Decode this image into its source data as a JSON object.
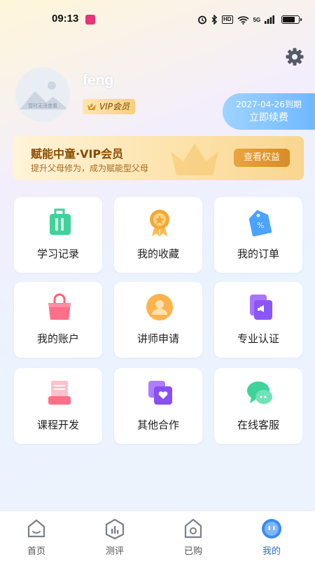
{
  "status_bar": {
    "time": "09:13",
    "net_badge": "HD",
    "sig_badge": "5G"
  },
  "profile": {
    "username": "feng",
    "avatar_caption": "暂时无法查看",
    "vip_badge": "VIP会员",
    "renew_date": "2027-04-26到期",
    "renew_button": "立即续费"
  },
  "vip_banner": {
    "title": "赋能中童·VIP会员",
    "subtitle": "提升父母修为，成为赋能型父母",
    "button": "查看权益"
  },
  "grid": [
    {
      "label": "学习记录",
      "icon": "study-record-icon"
    },
    {
      "label": "我的收藏",
      "icon": "favorites-medal-icon"
    },
    {
      "label": "我的订单",
      "icon": "orders-tag-icon"
    },
    {
      "label": "我的账户",
      "icon": "account-bag-icon"
    },
    {
      "label": "讲师申请",
      "icon": "lecturer-avatar-icon"
    },
    {
      "label": "专业认证",
      "icon": "certification-icon"
    },
    {
      "label": "课程开发",
      "icon": "course-dev-icon"
    },
    {
      "label": "其他合作",
      "icon": "cooperation-icon"
    },
    {
      "label": "在线客服",
      "icon": "customer-service-icon"
    }
  ],
  "tabbar": [
    {
      "label": "首页",
      "icon": "home-icon"
    },
    {
      "label": "测评",
      "icon": "assessment-icon"
    },
    {
      "label": "已购",
      "icon": "purchased-icon"
    },
    {
      "label": "我的",
      "icon": "profile-icon",
      "active": true
    }
  ],
  "colors": {
    "accent": "#2f6bd6",
    "vip_gold": "#d98b24",
    "renew_blue": "#6fb8ff"
  }
}
